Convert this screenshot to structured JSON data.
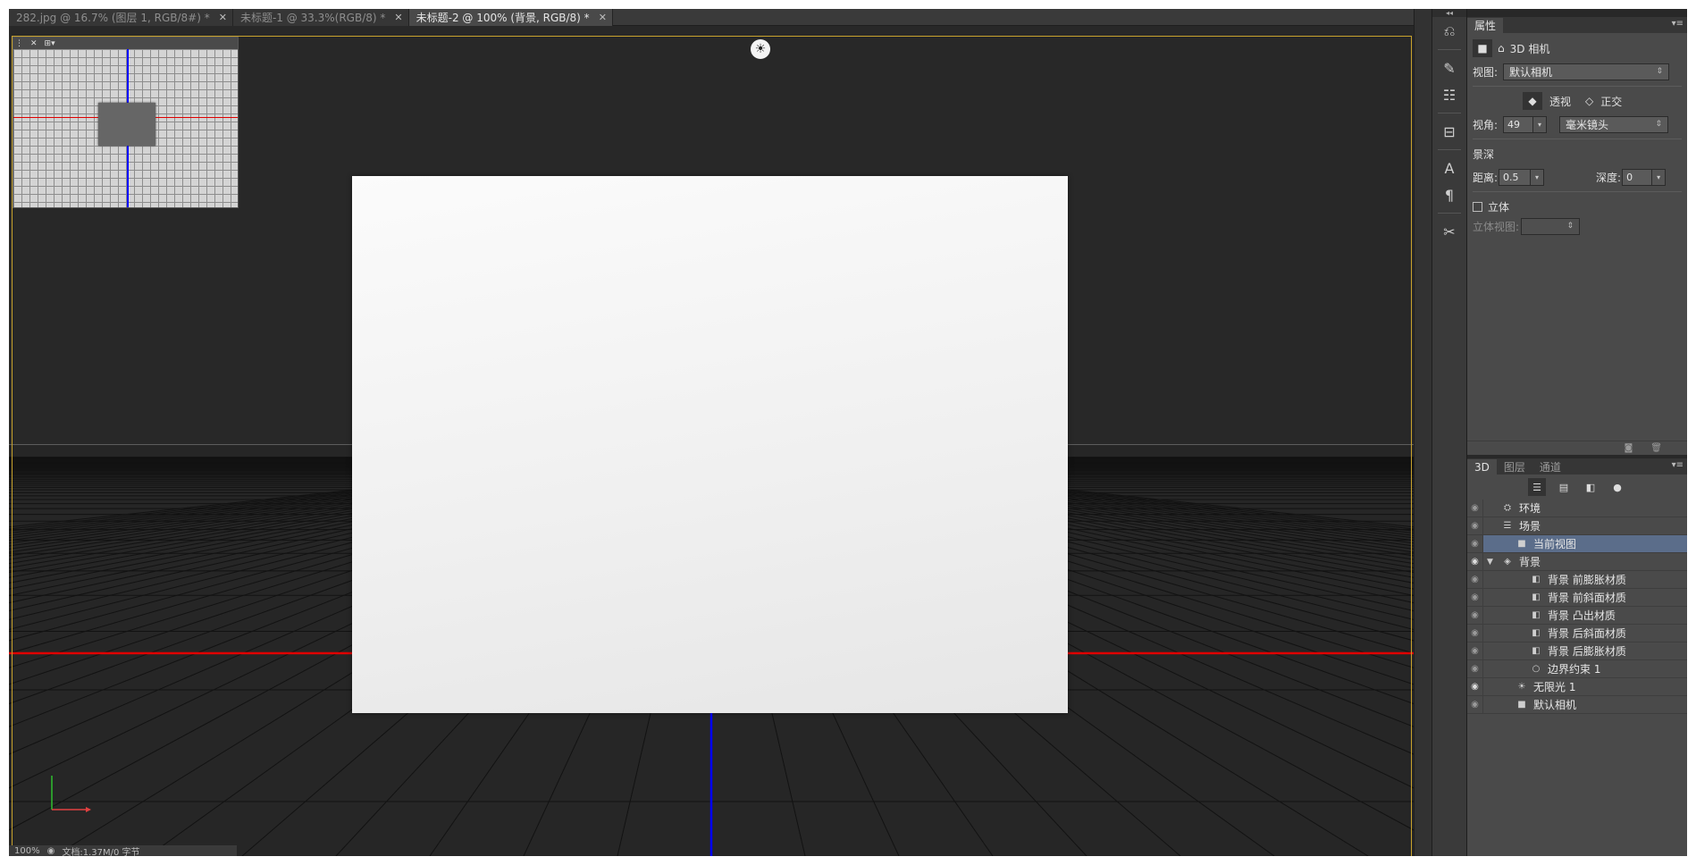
{
  "tabs": [
    {
      "label": "282.jpg @ 16.7% (图层 1, RGB/8#) *",
      "active": false
    },
    {
      "label": "未标题-1 @ 33.3%(RGB/8) *",
      "active": false
    },
    {
      "label": "未标题-2 @ 100% (背景, RGB/8) *",
      "active": true
    }
  ],
  "status": {
    "zoom": "100%",
    "doc": "文档:1.37M/0 字节"
  },
  "properties": {
    "tab": "属性",
    "header": "3D 相机",
    "view_label": "视图:",
    "view_value": "默认相机",
    "perspective": "透视",
    "orthographic": "正交",
    "fov_label": "视角:",
    "fov_value": "49",
    "lens_value": "毫米镜头",
    "dof_label": "景深",
    "distance_label": "距离:",
    "distance_value": "0.5",
    "depth_label": "深度:",
    "depth_value": "0",
    "stereo_label": "立体",
    "stereo_view_label": "立体视图:"
  },
  "scene_panel": {
    "tabs": [
      "3D",
      "图层",
      "通道"
    ],
    "items": [
      {
        "label": "环境",
        "indent": 0,
        "icon": "environment-icon",
        "glyph": "⛭",
        "eye": false,
        "twirl": "",
        "selected": false
      },
      {
        "label": "场景",
        "indent": 0,
        "icon": "scene-icon",
        "glyph": "☰",
        "eye": false,
        "twirl": "",
        "selected": false
      },
      {
        "label": "当前视图",
        "indent": 1,
        "icon": "camera-icon",
        "glyph": "■",
        "eye": false,
        "twirl": "",
        "selected": true
      },
      {
        "label": "背景",
        "indent": 0,
        "icon": "mesh-icon",
        "glyph": "◈",
        "eye": true,
        "twirl": "▼",
        "selected": false
      },
      {
        "label": "背景 前膨胀材质",
        "indent": 2,
        "icon": "material-icon",
        "glyph": "◧",
        "eye": false,
        "twirl": "",
        "selected": false
      },
      {
        "label": "背景 前斜面材质",
        "indent": 2,
        "icon": "material-icon",
        "glyph": "◧",
        "eye": false,
        "twirl": "",
        "selected": false
      },
      {
        "label": "背景 凸出材质",
        "indent": 2,
        "icon": "material-icon",
        "glyph": "◧",
        "eye": false,
        "twirl": "",
        "selected": false
      },
      {
        "label": "背景 后斜面材质",
        "indent": 2,
        "icon": "material-icon",
        "glyph": "◧",
        "eye": false,
        "twirl": "",
        "selected": false
      },
      {
        "label": "背景 后膨胀材质",
        "indent": 2,
        "icon": "material-icon",
        "glyph": "◧",
        "eye": false,
        "twirl": "",
        "selected": false
      },
      {
        "label": "边界约束 1",
        "indent": 2,
        "icon": "constraint-icon",
        "glyph": "○",
        "eye": false,
        "twirl": "",
        "selected": false
      },
      {
        "label": "无限光 1",
        "indent": 1,
        "icon": "infinite-light-icon",
        "glyph": "☀",
        "eye": true,
        "twirl": "",
        "selected": false
      },
      {
        "label": "默认相机",
        "indent": 1,
        "icon": "camera-icon",
        "glyph": "■",
        "eye": false,
        "twirl": "",
        "selected": false
      }
    ]
  },
  "colors": {
    "accent_frame": "#c9a32d",
    "x_axis": "#e00000",
    "y_axis": "#0000ff",
    "selection": "#5b6d8a"
  }
}
